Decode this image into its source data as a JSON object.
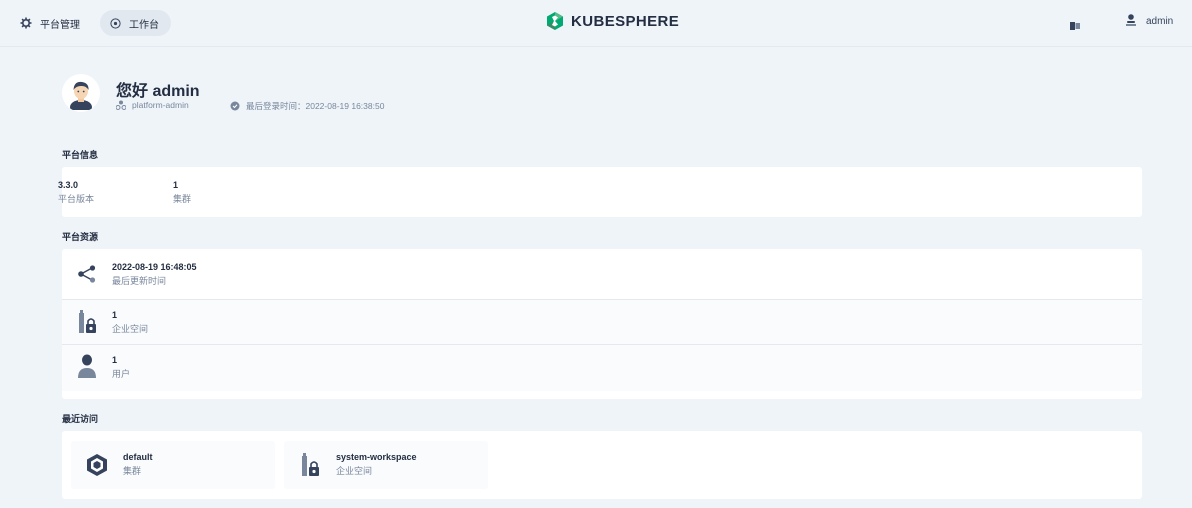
{
  "header": {
    "platform_label": "平台管理",
    "workbench_label": "工作台",
    "logo_text": "KUBESPHERE",
    "user_name": "admin"
  },
  "welcome": {
    "greeting": "您好 admin",
    "role": "platform-admin",
    "last_login": "最后登录时间：2022-08-19 16:38:50"
  },
  "platform_info": {
    "title": "平台信息",
    "stats": [
      {
        "value": "3.3.0",
        "label": "平台版本"
      },
      {
        "value": "1",
        "label": "集群"
      }
    ]
  },
  "platform_resources": {
    "title": "平台资源",
    "rows": [
      {
        "value": "2022-08-19 16:48:05",
        "label": "最后更新时间",
        "icon": "share-nodes-icon"
      },
      {
        "value": "1",
        "label": "企业空间",
        "icon": "workspace-lock-icon"
      },
      {
        "value": "1",
        "label": "用户",
        "icon": "user-icon"
      }
    ]
  },
  "recent": {
    "title": "最近访问",
    "items": [
      {
        "name": "default",
        "type": "集群",
        "icon": "cluster-icon"
      },
      {
        "name": "system-workspace",
        "type": "企业空间",
        "icon": "workspace-lock-icon"
      }
    ]
  },
  "colors": {
    "background": "#eff4f9",
    "card": "#ffffff",
    "text_primary": "#242e42",
    "text_secondary": "#79879c",
    "brand_green": "#00aa72"
  }
}
